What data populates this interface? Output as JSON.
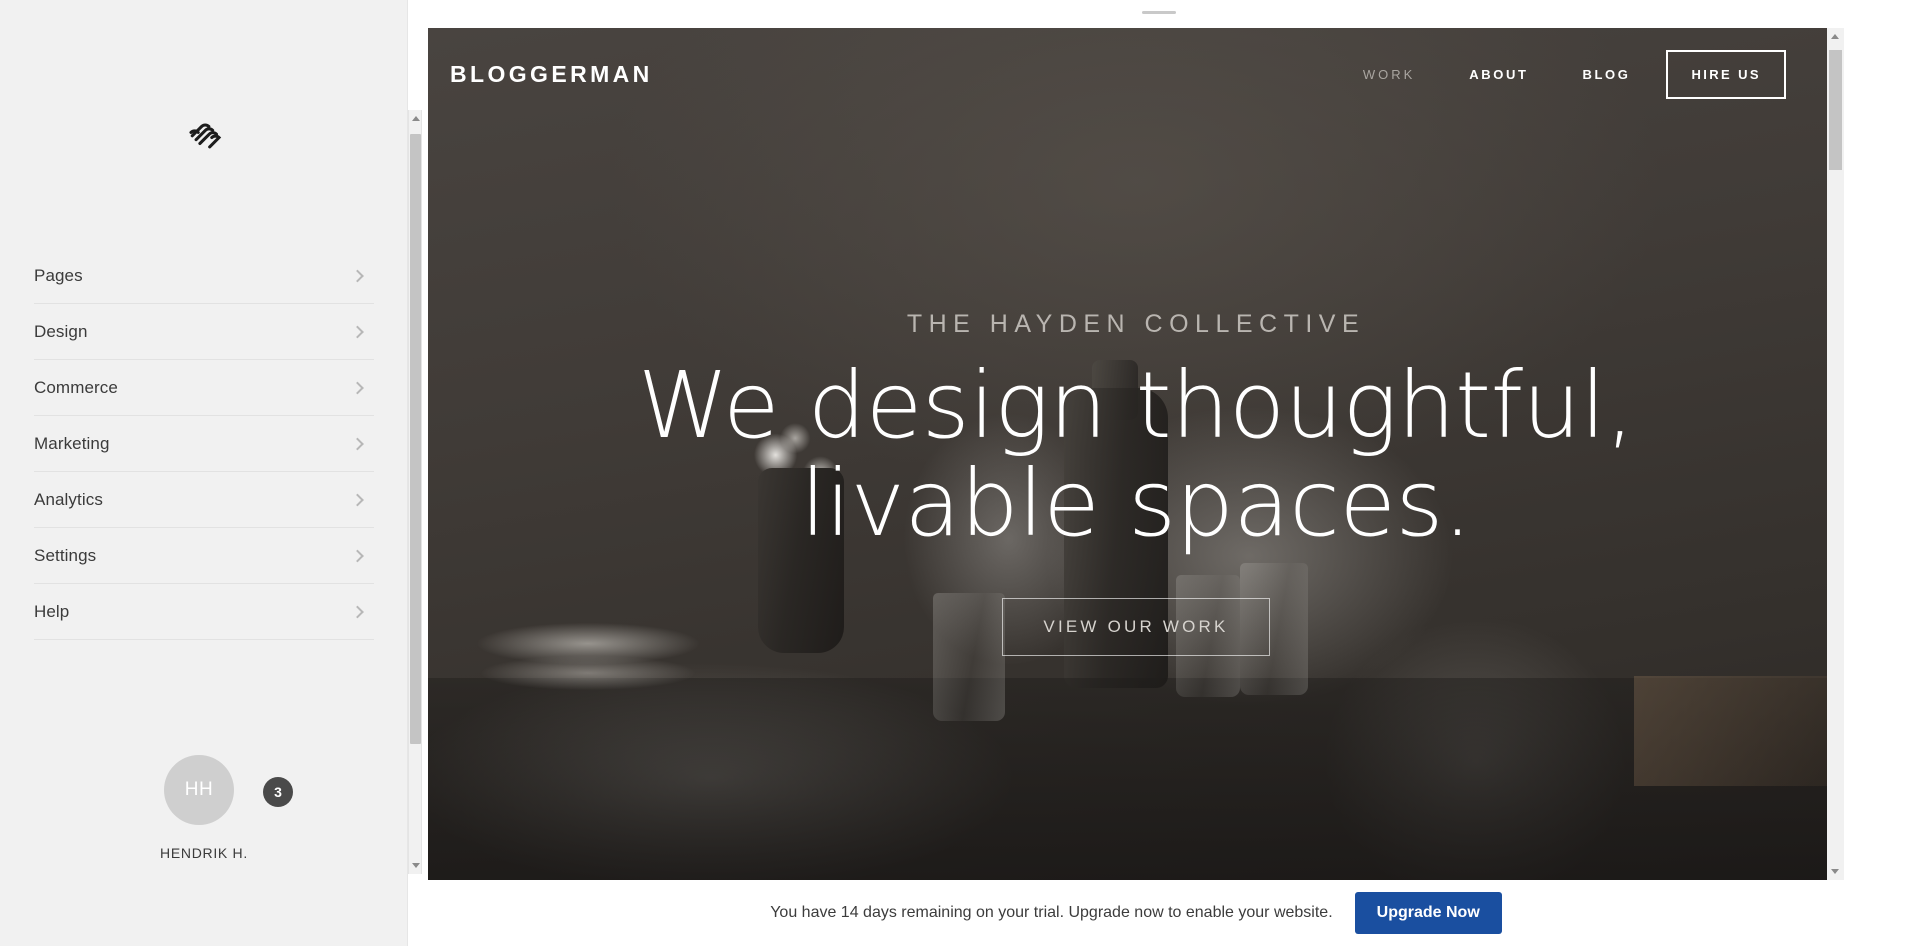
{
  "sidebar": {
    "logo_icon": "squarespace-logo-icon",
    "nav_items": [
      {
        "label": "Pages",
        "chevron": "chevron-right-icon"
      },
      {
        "label": "Design",
        "chevron": "chevron-right-icon"
      },
      {
        "label": "Commerce",
        "chevron": "chevron-right-icon"
      },
      {
        "label": "Marketing",
        "chevron": "chevron-right-icon"
      },
      {
        "label": "Analytics",
        "chevron": "chevron-right-icon"
      },
      {
        "label": "Settings",
        "chevron": "chevron-right-icon"
      },
      {
        "label": "Help",
        "chevron": "chevron-right-icon"
      }
    ],
    "account": {
      "avatar_initials": "HH",
      "notification_count": "3",
      "name": "HENDRIK H."
    }
  },
  "preview": {
    "site_logo": "BLOGGERMAN",
    "nav": [
      {
        "label": "WORK",
        "state": "muted"
      },
      {
        "label": "ABOUT",
        "state": "active"
      },
      {
        "label": "BLOG",
        "state": "active"
      }
    ],
    "hire_button": "HIRE US",
    "hero": {
      "eyebrow": "THE HAYDEN COLLECTIVE",
      "headline_line1": "We design thoughtful,",
      "headline_line2": "livable spaces.",
      "cta_label": "VIEW OUR WORK"
    },
    "scrollbar": {
      "up_icon": "arrow-up-icon",
      "down_icon": "arrow-down-icon"
    }
  },
  "trial": {
    "message": "You have 14 days remaining on your trial. Upgrade now to enable your website.",
    "button_label": "Upgrade Now",
    "button_color": "#1a4fa0"
  },
  "colors": {
    "sidebar_bg": "#f1f1f1",
    "hero_dark": "#3d3935",
    "accent_blue": "#1a4fa0",
    "text_dark": "#3b3b3b"
  }
}
